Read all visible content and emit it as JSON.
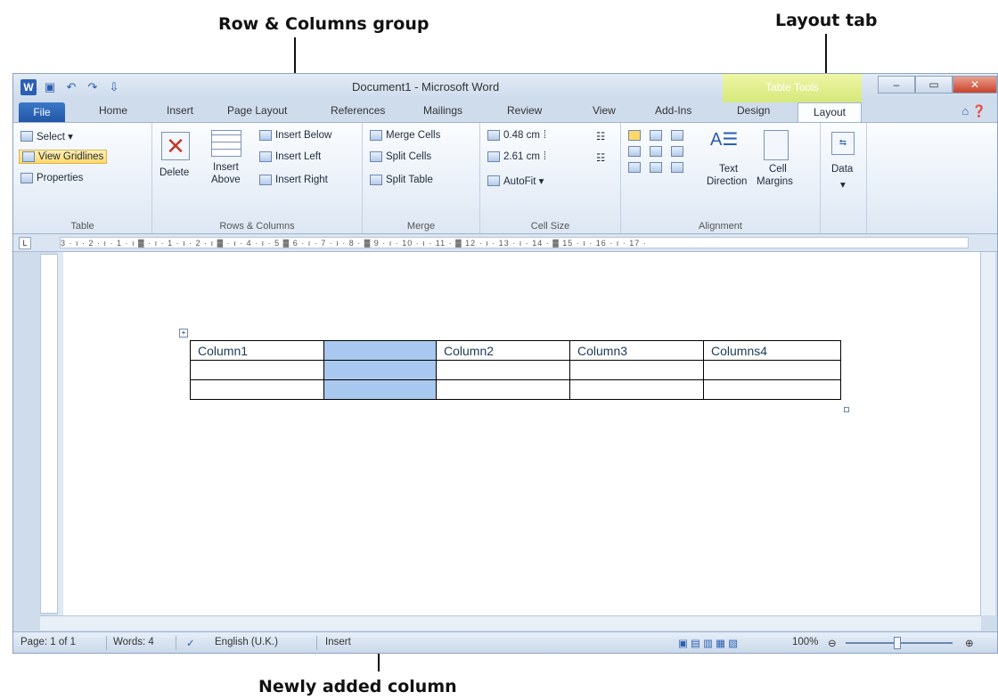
{
  "annotations": {
    "rows_columns_group": "Row & Columns group",
    "layout_tab": "Layout tab",
    "newly_added_column": "Newly added column"
  },
  "window": {
    "title": "Document1 - Microsoft Word",
    "contextual_tab_group": "Table Tools"
  },
  "tabs": [
    "File",
    "Home",
    "Insert",
    "Page Layout",
    "References",
    "Mailings",
    "Review",
    "View",
    "Add-Ins",
    "Design",
    "Layout"
  ],
  "active_tab": "Layout",
  "ribbon": {
    "table": {
      "label": "Table",
      "select": "Select ▾",
      "view_gridlines": "View Gridlines",
      "properties": "Properties"
    },
    "rows_columns": {
      "label": "Rows & Columns",
      "delete": "Delete",
      "insert_above_1": "Insert",
      "insert_above_2": "Above",
      "insert_below": "Insert Below",
      "insert_left": "Insert Left",
      "insert_right": "Insert Right"
    },
    "merge": {
      "label": "Merge",
      "merge_cells": "Merge Cells",
      "split_cells": "Split Cells",
      "split_table": "Split Table"
    },
    "cell_size": {
      "label": "Cell Size",
      "height": "0.48 cm",
      "width": "2.61 cm",
      "autofit": "AutoFit ▾"
    },
    "alignment": {
      "label": "Alignment",
      "text_direction_1": "Text",
      "text_direction_2": "Direction",
      "cell_margins_1": "Cell",
      "cell_margins_2": "Margins"
    },
    "data": {
      "label": "Data"
    }
  },
  "ruler_text": "3 · ı · 2 · ı · 1 · ı ▓ · ı · 1 · ı · 2 · ı ▓ · ı · 4 · ı · 5 ▓ 6 · ı · 7 · ı · 8 · ▓ 9 · ı · 10 · ı · 11 · ▓ 12 · ı · 13 · ı · 14 · ▓ 15 · ı · 16 · ı · 17 ·",
  "table": {
    "header": [
      "Column1",
      "",
      "Column2",
      "Column3",
      "Columns4"
    ],
    "rows": [
      [
        "",
        "",
        "",
        "",
        ""
      ],
      [
        "",
        "",
        "",
        "",
        ""
      ]
    ]
  },
  "status": {
    "page": "Page: 1 of 1",
    "words": "Words: 4",
    "language": "English (U.K.)",
    "mode": "Insert",
    "zoom": "100%"
  }
}
